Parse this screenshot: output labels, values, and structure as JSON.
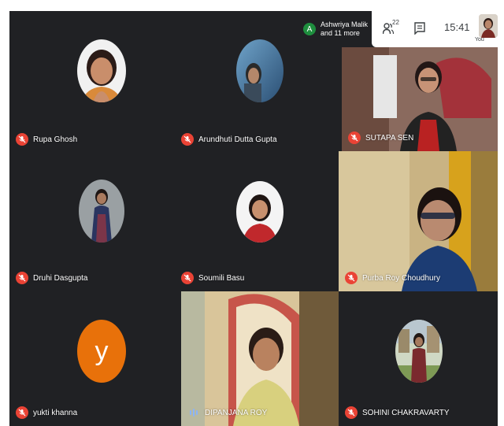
{
  "presenter": {
    "initial": "A",
    "line1": "Ashwriya Malik",
    "line2": "and 11 more"
  },
  "toolbar": {
    "participant_count": "22",
    "time": "15:41",
    "self_label": "You"
  },
  "participants": [
    {
      "name": "Rupa Ghosh",
      "muted": true
    },
    {
      "name": "Arundhuti Dutta Gupta",
      "muted": true
    },
    {
      "name": "SUTAPA SEN",
      "muted": true
    },
    {
      "name": "Druhi Dasgupta",
      "muted": true
    },
    {
      "name": "Soumili Basu",
      "muted": true
    },
    {
      "name": "Purba Roy Choudhury",
      "muted": true
    },
    {
      "name": "yukti khanna",
      "muted": true,
      "initial": "y",
      "avatar_color": "#e8710a"
    },
    {
      "name": "DIPANJANA ROY",
      "muted": false,
      "speaking": true
    },
    {
      "name": "SOHINI CHAKRAVARTY",
      "muted": true
    }
  ]
}
